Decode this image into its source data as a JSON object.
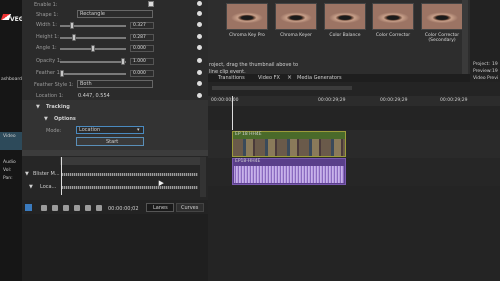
{
  "app": {
    "logo_text": "VEGAS"
  },
  "left_strip": {
    "dashboard_label": "ashboard",
    "video_label": "Video",
    "audio_label": "Audio",
    "vol_label": "Vol:",
    "pan_label": "Pan:"
  },
  "params": {
    "enable_label": "Enable 1:",
    "shape_label": "Shape 1:",
    "shape_value": "Rectangle",
    "width_label": "Width 1:",
    "width_value": "0.327",
    "height_label": "Height 1:",
    "height_value": "0.287",
    "angle_label": "Angle 1:",
    "angle_value": "0.000",
    "opacity_label": "Opacity 1:",
    "opacity_value": "1.000",
    "feather_label": "Feather 1:",
    "feather_value": "0.000",
    "feather_style_label": "Feather Style 1:",
    "feather_style_value": "Both",
    "location_label": "Location 1:",
    "location_value": "0.447, 0.554"
  },
  "tracking": {
    "section_label": "Tracking",
    "options_label": "Options",
    "mode_label": "Mode:",
    "mode_value": "Location",
    "start_label": "Start"
  },
  "automation": {
    "row1_label": "Blister M...",
    "row2_label": "Loca...",
    "time_value": "00:00:00;02",
    "tab_lanes": "Lanes",
    "tab_curves": "Curves"
  },
  "fx_browser": {
    "items": [
      {
        "label": "Chroma Key Pro"
      },
      {
        "label": "Chroma Keyer"
      },
      {
        "label": "Color Balance"
      },
      {
        "label": "Color Corrector"
      },
      {
        "label": "Color Corrector (Secondary)"
      }
    ],
    "hint_line1": "roject, drag the thumbnail above to",
    "hint_line2": "line clip event."
  },
  "tabs": {
    "transitions": "Transitions",
    "video_fx": "Video FX",
    "media_generators": "Media Generators"
  },
  "right_info": {
    "project": "Project:",
    "project_val": "19",
    "preview": "Preview:",
    "preview_val": "19",
    "video_prev": "Video Previ"
  },
  "ruler": {
    "t0": "00:00:00;00",
    "t1": "00:00:29;29",
    "t2": "00:00:29;29",
    "t3": "00:00:29;29"
  },
  "timeline": {
    "video_event_label": "EP 18 HH4E",
    "audio_event_label": "EP18-HH4E"
  }
}
